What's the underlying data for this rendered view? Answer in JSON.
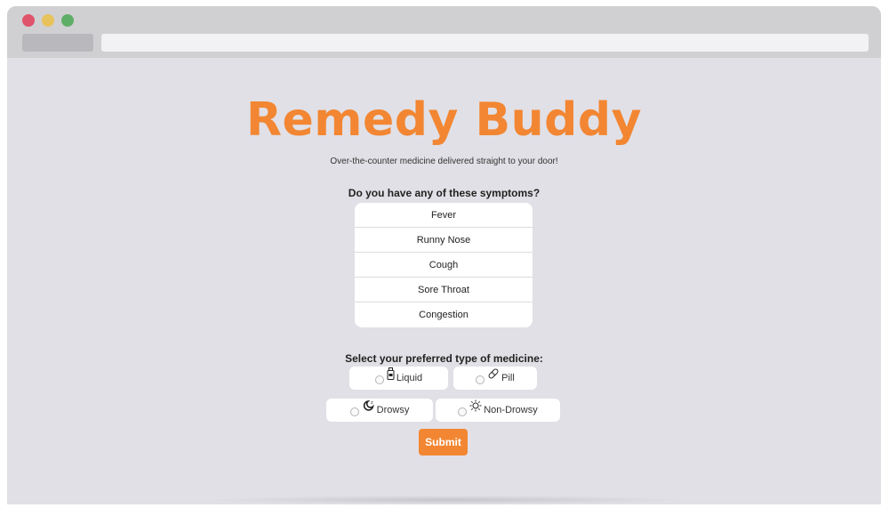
{
  "app": {
    "title": "Remedy Buddy",
    "tagline": "Over-the-counter medicine delivered straight to your door!"
  },
  "symptoms": {
    "question": "Do you have any of these symptoms?",
    "items": [
      {
        "label": "Fever"
      },
      {
        "label": "Runny Nose"
      },
      {
        "label": "Cough"
      },
      {
        "label": "Sore Throat"
      },
      {
        "label": "Congestion"
      }
    ]
  },
  "medicine": {
    "question": "Select your preferred type of medicine:",
    "form_options": [
      {
        "label": "Liquid",
        "icon": "bottle-icon"
      },
      {
        "label": "Pill",
        "icon": "pill-icon"
      }
    ],
    "drowsiness_options": [
      {
        "label": "Drowsy",
        "icon": "moon-icon"
      },
      {
        "label": "Non-Drowsy",
        "icon": "sun-icon"
      }
    ]
  },
  "submit_label": "Submit",
  "colors": {
    "accent": "#f28632",
    "page_bg": "#e1e0e6",
    "card_bg": "#ffffff"
  }
}
